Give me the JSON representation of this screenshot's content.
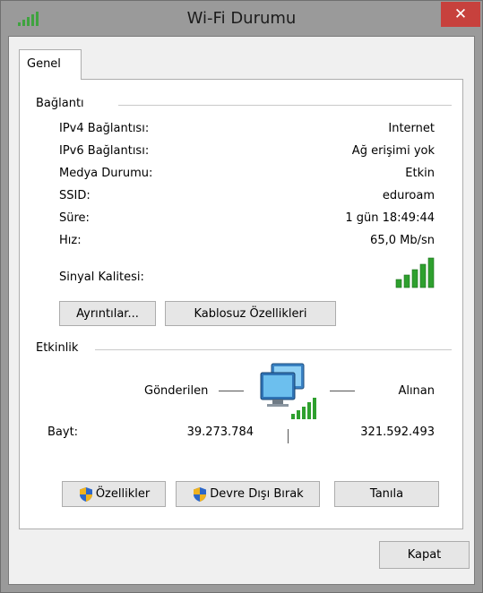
{
  "window": {
    "title": "Wi-Fi Durumu",
    "close_glyph": "✕",
    "title_icon": "wifi-signal-icon"
  },
  "tabs": [
    {
      "label": "Genel",
      "selected": true
    }
  ],
  "connection": {
    "heading": "Bağlantı",
    "rows": [
      {
        "label": "IPv4 Bağlantısı:",
        "value": "Internet"
      },
      {
        "label": "IPv6 Bağlantısı:",
        "value": "Ağ erişimi yok"
      },
      {
        "label": "Medya Durumu:",
        "value": "Etkin"
      },
      {
        "label": "SSID:",
        "value": "eduroam"
      },
      {
        "label": "Süre:",
        "value": "1 gün 18:49:44"
      },
      {
        "label": "Hız:",
        "value": "65,0 Mb/sn"
      }
    ],
    "signal_label": "Sinyal Kalitesi:",
    "signal_bars_lit": 5,
    "signal_bars_total": 5,
    "details_button": "Ayrıntılar...",
    "wireless_props_button": "Kablosuz Özellikleri"
  },
  "activity": {
    "heading": "Etkinlik",
    "sent_label": "Gönderilen",
    "received_label": "Alınan",
    "bytes_label": "Bayt:",
    "bytes_sent": "39.273.784",
    "bytes_received": "321.592.493",
    "icon": "network-computers-icon"
  },
  "actions": {
    "properties_button": "Özellikler",
    "disable_button": "Devre Dışı Bırak",
    "diagnose_button": "Tanıla"
  },
  "footer": {
    "close_button": "Kapat"
  },
  "colors": {
    "close_red": "#c7413d",
    "signal_green": "#2ea02e",
    "frame_gray": "#9a9a9a",
    "dialog_bg": "#f0f0f0"
  }
}
